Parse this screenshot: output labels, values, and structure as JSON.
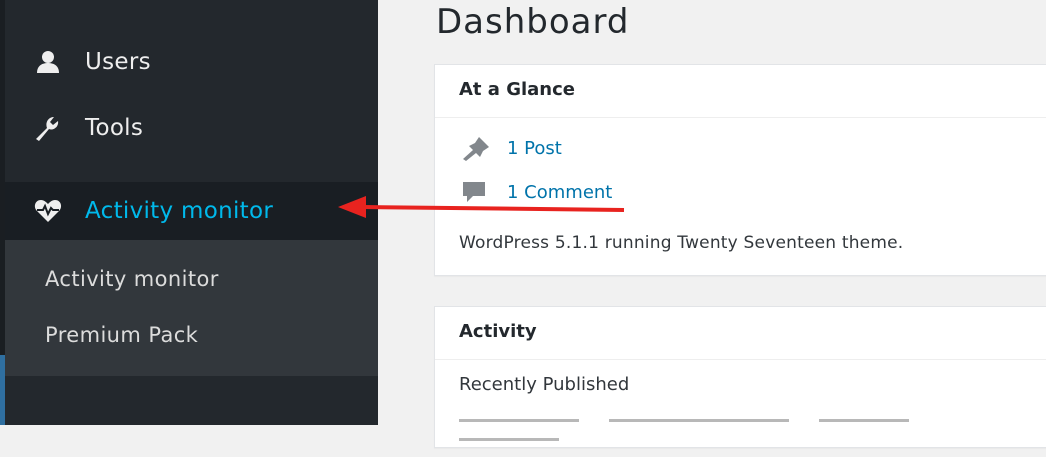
{
  "sidebar": {
    "items": [
      {
        "label": "Users",
        "icon": "user-icon"
      },
      {
        "label": "Tools",
        "icon": "wrench-icon"
      },
      {
        "label": "Activity monitor",
        "icon": "heartbeat-icon"
      }
    ],
    "submenu": [
      {
        "label": "Activity monitor"
      },
      {
        "label": "Premium Pack"
      }
    ],
    "colors": {
      "background": "#23282d",
      "active": "#00b9eb",
      "submenu_bg": "#32373c"
    }
  },
  "main": {
    "title": "Dashboard",
    "at_a_glance": {
      "title": "At a Glance",
      "posts": "1 Post",
      "comments": "1 Comment",
      "footer": "WordPress 5.1.1 running Twenty Seventeen theme."
    },
    "activity": {
      "title": "Activity",
      "recently_published": "Recently Published"
    }
  },
  "annotation": {
    "color": "#e8231f"
  }
}
